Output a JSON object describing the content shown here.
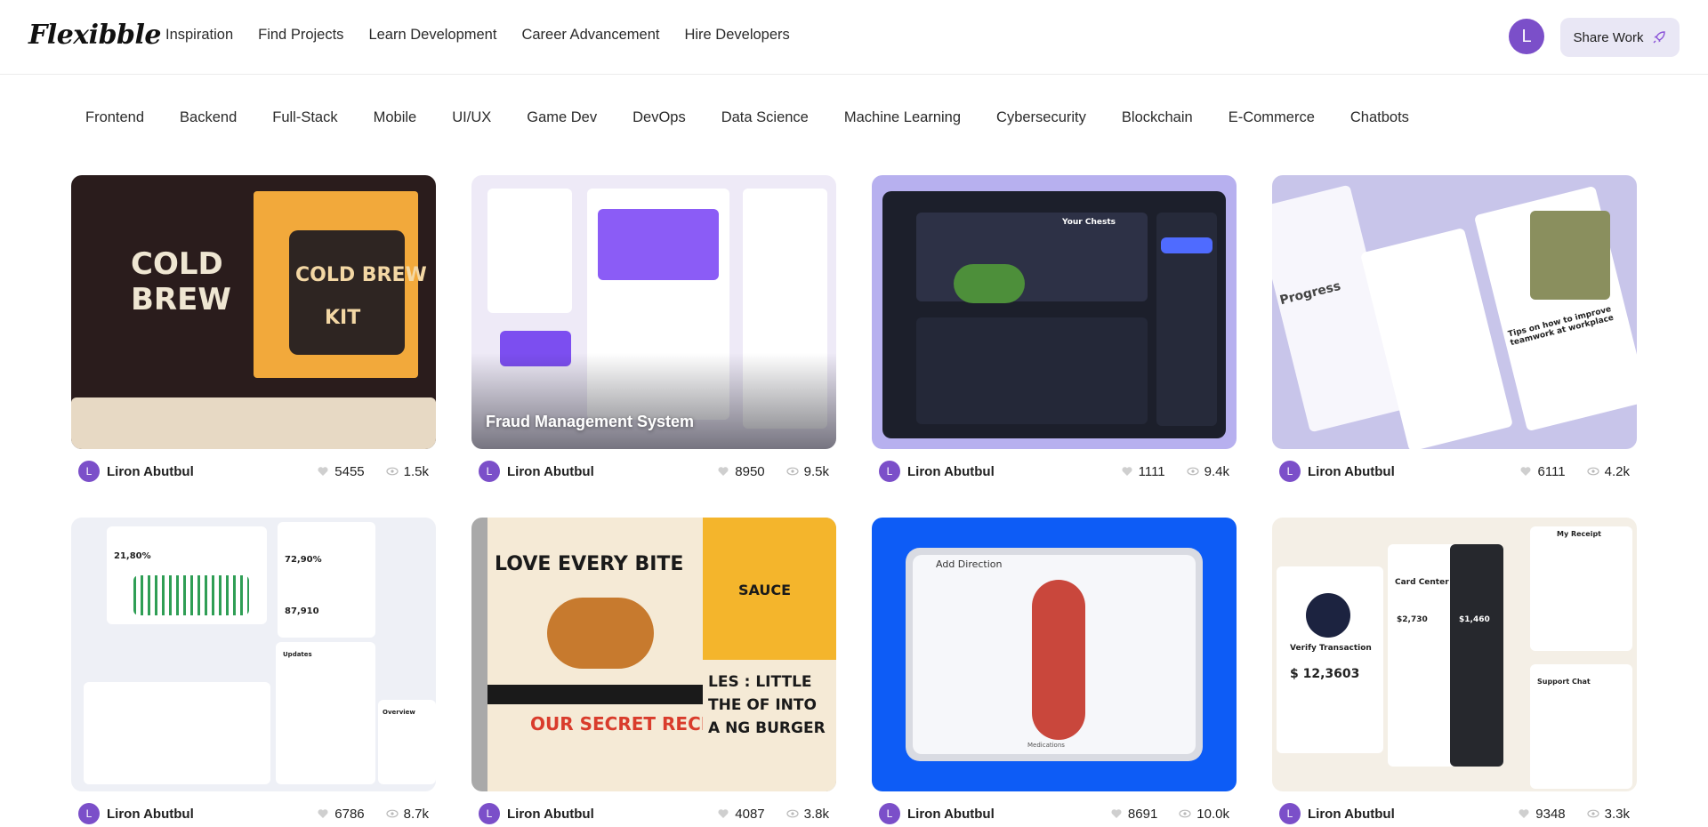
{
  "brand": {
    "logo": "Flexibble",
    "accent": "#7b4fc9"
  },
  "nav": {
    "links": [
      "Inspiration",
      "Find Projects",
      "Learn Development",
      "Career Advancement",
      "Hire Developers"
    ],
    "user_initial": "L",
    "share_label": "Share Work",
    "share_icon": "rocket-icon"
  },
  "categories": [
    "Frontend",
    "Backend",
    "Full-Stack",
    "Mobile",
    "UI/UX",
    "Game Dev",
    "DevOps",
    "Data Science",
    "Machine Learning",
    "Cybersecurity",
    "Blockchain",
    "E-Commerce",
    "Chatbots"
  ],
  "projects": [
    {
      "title": "",
      "author": "Liron Abutbul",
      "initial": "L",
      "likes": "5455",
      "views": "1.5k",
      "thumb_text": [
        "COLD",
        "BREW",
        "COLD BREW",
        "KIT"
      ]
    },
    {
      "title": "Fraud Management System",
      "author": "Liron Abutbul",
      "initial": "L",
      "likes": "8950",
      "views": "9.5k",
      "thumb_text": []
    },
    {
      "title": "",
      "author": "Liron Abutbul",
      "initial": "L",
      "likes": "1111",
      "views": "9.4k",
      "thumb_text": [
        "Your Chests"
      ]
    },
    {
      "title": "",
      "author": "Liron Abutbul",
      "initial": "L",
      "likes": "6111",
      "views": "4.2k",
      "thumb_text": [
        "Progress",
        "Tips on how to improve teamwork at workplace"
      ]
    },
    {
      "title": "",
      "author": "Liron Abutbul",
      "initial": "L",
      "likes": "6786",
      "views": "8.7k",
      "thumb_text": [
        "21,80%",
        "72,90%",
        "87,910",
        "Updates",
        "Overview"
      ]
    },
    {
      "title": "",
      "author": "Liron Abutbul",
      "initial": "L",
      "likes": "4087",
      "views": "3.8k",
      "thumb_text": [
        "LOVE EVERY BITE",
        "OUR SECRET RECIPE",
        "SAUCE",
        "LES : LITTLE THE OF INTO A NG BURGER"
      ]
    },
    {
      "title": "",
      "author": "Liron Abutbul",
      "initial": "L",
      "likes": "8691",
      "views": "10.0k",
      "thumb_text": [
        "Add Direction",
        "Medications"
      ]
    },
    {
      "title": "",
      "author": "Liron Abutbul",
      "initial": "L",
      "likes": "9348",
      "views": "3.3k",
      "thumb_text": [
        "Verify Transaction",
        "$ 12,3603",
        "Card Center",
        "$2,730",
        "$1,460",
        "Support Chat",
        "My Receipt"
      ]
    }
  ]
}
